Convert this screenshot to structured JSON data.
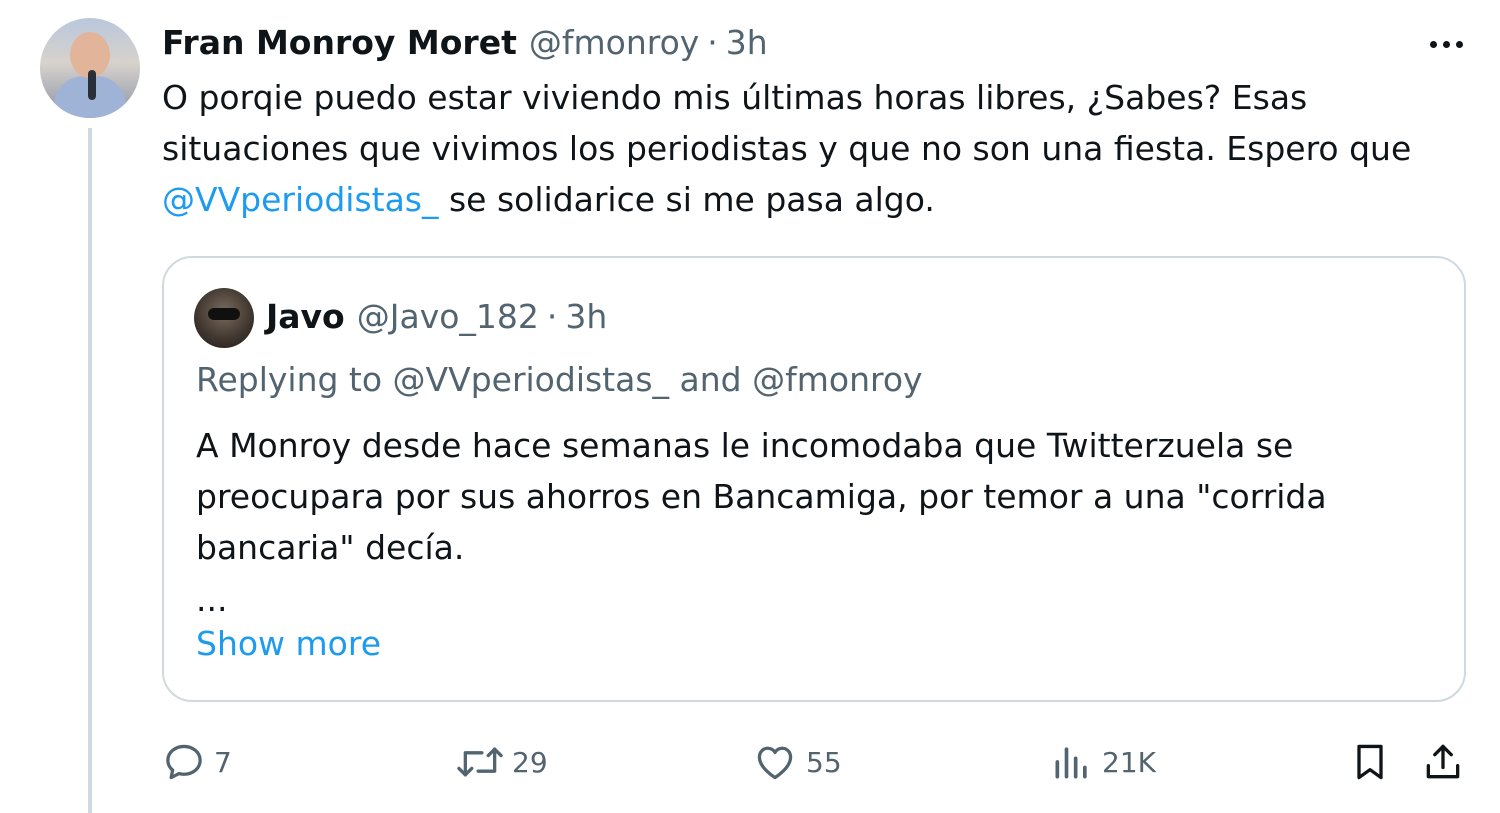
{
  "tweet": {
    "author_name": "Fran Monroy Moret",
    "handle": "@fmonroy",
    "separator": "·",
    "time": "3h",
    "text_before": "O porqie puedo estar viviendo mis últimas horas libres, ¿Sabes? Esas situaciones que vivimos los periodistas y que no son una fiesta. Espero que ",
    "mention": "@VVperiodistas_",
    "text_after": " se solidarice si me pasa algo."
  },
  "quote": {
    "author_name": "Javo",
    "handle": "@Javo_182",
    "separator": "·",
    "time": "3h",
    "replying_prefix": "Replying to ",
    "replying_mention_1": "@VVperiodistas_",
    "replying_and": " and ",
    "replying_mention_2": "@fmonroy",
    "text": "A Monroy desde hace semanas le incomodaba que Twitterzuela se preocupara por sus ahorros en Bancamiga, por temor a una \"corrida bancaria\" decía.",
    "ellipsis": "...",
    "show_more": "Show more"
  },
  "actions": {
    "replies": "7",
    "retweets": "29",
    "likes": "55",
    "views": "21K"
  },
  "icons": {
    "more": "more-icon",
    "reply": "reply-icon",
    "retweet": "retweet-icon",
    "like": "heart-icon",
    "views": "views-icon",
    "bookmark": "bookmark-icon",
    "share": "share-icon"
  },
  "colors": {
    "text": "#0f1419",
    "secondary": "#536471",
    "link": "#1d9bf0",
    "border": "#cfd9de"
  }
}
